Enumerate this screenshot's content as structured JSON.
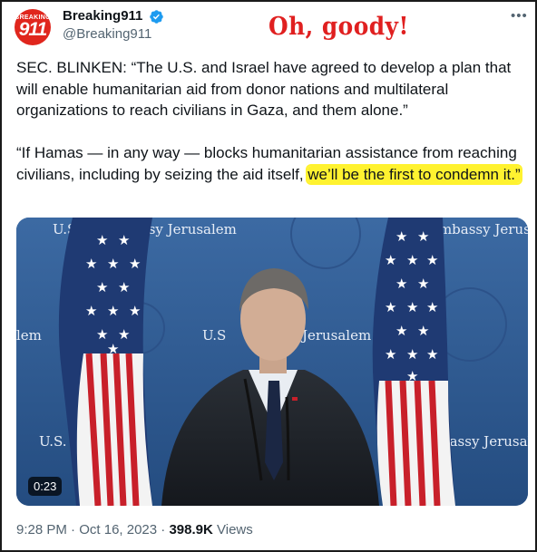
{
  "author": {
    "avatar_top_text": "BREAKING",
    "avatar_number": "911",
    "display_name": "Breaking911",
    "handle": "@Breaking911"
  },
  "annotation": "Oh, goody!",
  "more_icon": "•••",
  "tweet": {
    "paragraph1": "SEC. BLINKEN: “The U.S. and Israel have agreed to develop a plan that will enable humanitarian aid from donor nations and multilateral organizations to reach civilians in Gaza, and them alone.”",
    "paragraph2_plain": "“If Hamas — in any way — blocks humanitarian assistance from reaching civilians, including by seizing the aid itself, ",
    "paragraph2_highlight": "we’ll be the first to condemn it.”"
  },
  "media": {
    "backdrop_text_left": "U.S. E",
    "backdrop_text_top_mid": "ssy Jerusalem",
    "backdrop_text_top_right": "Embassy Jerus",
    "backdrop_text_mid_left": "lem",
    "backdrop_text_mid_center": "U.S",
    "backdrop_text_mid_center2": "sy Jerusalem",
    "backdrop_text_low_left": "U.S.",
    "backdrop_text_low_right": "bassy Jerusale",
    "duration": "0:23"
  },
  "footer": {
    "time": "9:28 PM",
    "sep1": " · ",
    "date": "Oct 16, 2023",
    "sep2": " · ",
    "views_count": "398.9K",
    "views_label": " Views"
  },
  "colors": {
    "verified_blue": "#1d9bf0",
    "highlight": "#fff230",
    "annotation_red": "#e02020",
    "backdrop_blue": "#2e5b93"
  },
  "icons": [
    "verified-badge-icon",
    "more-options-icon"
  ]
}
